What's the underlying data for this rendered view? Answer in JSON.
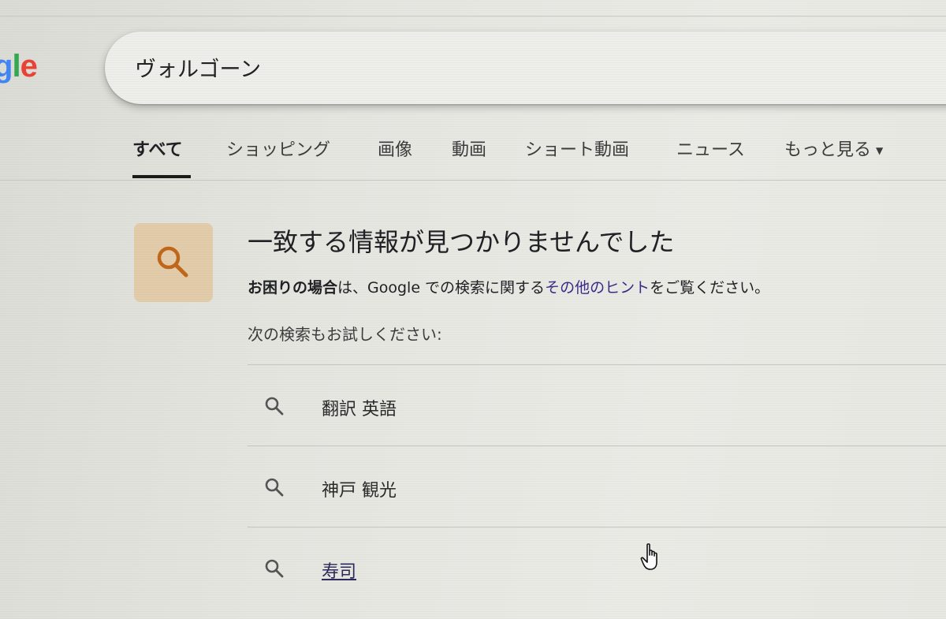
{
  "logo": {
    "part_g": "g",
    "part_l": "l",
    "part_e": "e"
  },
  "search": {
    "query": "ヴォルゴーン"
  },
  "tabs": [
    {
      "label": "すべて",
      "active": true
    },
    {
      "label": "ショッピング"
    },
    {
      "label": "画像"
    },
    {
      "label": "動画"
    },
    {
      "label": "ショート動画"
    },
    {
      "label": "ニュース"
    },
    {
      "label": "もっと見る"
    }
  ],
  "no_results": {
    "title": "一致する情報が見つかりませんでした",
    "help_bold": "お困りの場合",
    "help_text_1": "は、Google での検索に関する",
    "help_link": "その他のヒント",
    "help_text_2": "をご覧ください。",
    "try_label": "次の検索もお試しください:"
  },
  "suggestions": [
    {
      "text": "翻訳 英語"
    },
    {
      "text": "神戸 観光"
    },
    {
      "text": "寿司"
    }
  ],
  "icons": {
    "search": "search-icon",
    "dropdown": "chevron-down-icon",
    "cursor": "hand-pointer-icon"
  },
  "colors": {
    "icon_tile": "#e2ccaa",
    "icon_accent": "#c0671c",
    "link": "#3c2a8a"
  }
}
